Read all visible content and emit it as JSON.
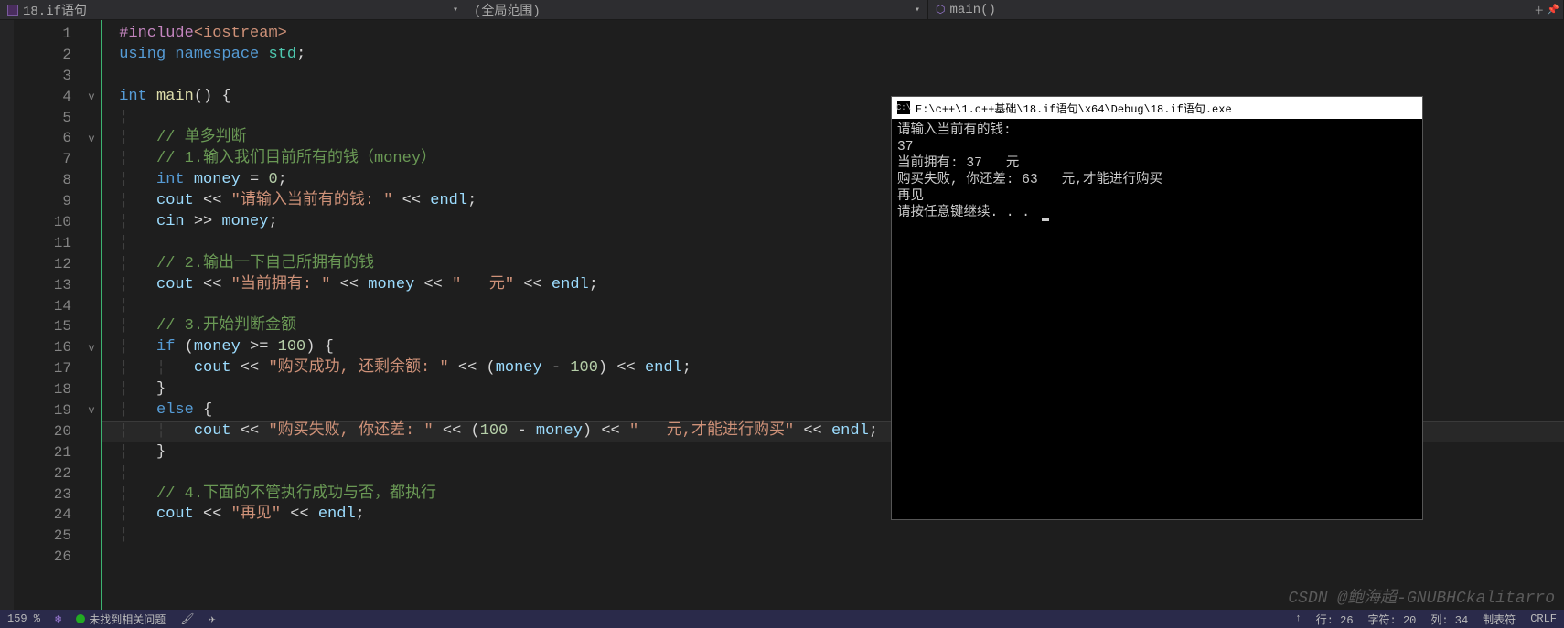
{
  "tabs": {
    "file": "18.if语句",
    "scope": "(全局范围)",
    "function": "main()"
  },
  "lines": [
    "1",
    "2",
    "3",
    "4",
    "5",
    "6",
    "7",
    "8",
    "9",
    "10",
    "11",
    "12",
    "13",
    "14",
    "15",
    "16",
    "17",
    "18",
    "19",
    "20",
    "21",
    "22",
    "23",
    "24",
    "25",
    "26"
  ],
  "folds": {
    "4": "v",
    "6": "v",
    "16": "v",
    "19": "v"
  },
  "code": {
    "l1": {
      "a": "#include",
      "b": "<iostream>"
    },
    "l2": {
      "a": "using",
      "b": "namespace",
      "c": "std",
      "d": ";"
    },
    "l4": {
      "a": "int",
      "b": "main",
      "c": "()",
      "d": "{"
    },
    "l6": "// 单多判断",
    "l7": "// 1.输入我们目前所有的钱（money）",
    "l8": {
      "a": "int",
      "b": "money",
      "c": "=",
      "d": "0",
      "e": ";"
    },
    "l9": {
      "a": "cout",
      "b": "<<",
      "c": "\"请输入当前有的钱: \"",
      "d": "<<",
      "e": "endl",
      "f": ";"
    },
    "l10": {
      "a": "cin",
      "b": ">>",
      "c": "money",
      "d": ";"
    },
    "l12": "// 2.输出一下自己所拥有的钱",
    "l13": {
      "a": "cout",
      "b": "<<",
      "c": "\"当前拥有: \"",
      "d": "<<",
      "e": "money",
      "f": "<<",
      "g": "\"   元\"",
      "h": "<<",
      "i": "endl",
      "j": ";"
    },
    "l15": "// 3.开始判断金额",
    "l16": {
      "a": "if",
      "b": "(",
      "c": "money",
      "d": ">=",
      "e": "100",
      "f": ")",
      "g": "{"
    },
    "l17": {
      "a": "cout",
      "b": "<<",
      "c": "\"购买成功, 还剩余额: \"",
      "d": "<<",
      "e": "(",
      "f": "money",
      "g": "-",
      "h": "100",
      "i": ")",
      "j": "<<",
      "k": "endl",
      "l": ";"
    },
    "l18": "}",
    "l19": {
      "a": "else",
      "b": "{"
    },
    "l20": {
      "a": "cout",
      "b": "<<",
      "c": "\"购买失败, 你还差: \"",
      "d": "<<",
      "e": "(",
      "f": "100",
      "g": "-",
      "h": "money",
      "i": ")",
      "j": "<<",
      "k": "\"   元,才能进行购买\"",
      "l": "<<",
      "m": "endl",
      "n": ";"
    },
    "l21": "}",
    "l23": "// 4.下面的不管执行成功与否，都执行",
    "l24": {
      "a": "cout",
      "b": "<<",
      "c": "\"再见\"",
      "d": "<<",
      "e": "endl",
      "f": ";"
    }
  },
  "console": {
    "title": "E:\\c++\\1.c++基础\\18.if语句\\x64\\Debug\\18.if语句.exe",
    "lines": [
      "请输入当前有的钱:",
      "37",
      "当前拥有: 37   元",
      "购买失败, 你还差: 63   元,才能进行购买",
      "再见",
      "请按任意键继续. . . "
    ]
  },
  "status": {
    "zoom": "159 %",
    "issues": "未找到相关问题",
    "ln": "行: 26",
    "ch": "字符: 20",
    "col": "列: 34",
    "tabs": "制表符",
    "eol": "CRLF"
  },
  "watermark": "CSDN @鲍海超-GNUBHCkalitarro"
}
